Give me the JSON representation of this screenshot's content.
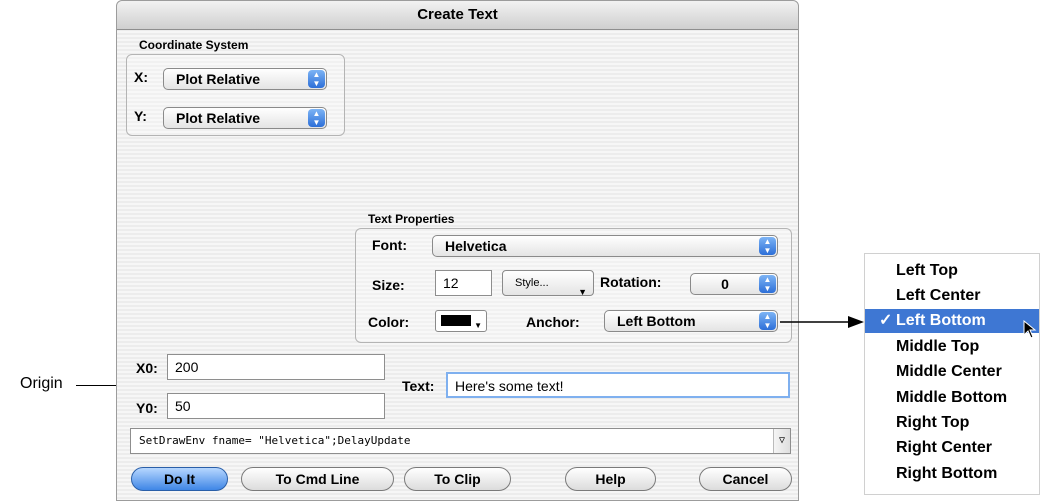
{
  "window": {
    "title": "Create Text"
  },
  "coordinate_system": {
    "label": "Coordinate System",
    "x_label": "X:",
    "x_value": "Plot Relative",
    "y_label": "Y:",
    "y_value": "Plot Relative"
  },
  "text_properties": {
    "label": "Text Properties",
    "font_label": "Font:",
    "font_value": "Helvetica",
    "size_label": "Size:",
    "size_value": "12",
    "style_label": "Style...",
    "rotation_label": "Rotation:",
    "rotation_value": "0",
    "color_label": "Color:",
    "anchor_label": "Anchor:",
    "anchor_value": "Left Bottom"
  },
  "origin": {
    "annotation": "Origin",
    "x0_label": "X0:",
    "x0_value": "200",
    "y0_label": "Y0:",
    "y0_value": "50"
  },
  "text_field": {
    "label": "Text:",
    "value": "Here's some text!"
  },
  "command_line": {
    "value": "SetDrawEnv fname= \"Helvetica\";DelayUpdate"
  },
  "buttons": {
    "do_it": "Do It",
    "to_cmd_line": "To Cmd Line",
    "to_clip": "To Clip",
    "help": "Help",
    "cancel": "Cancel"
  },
  "anchor_menu": {
    "items": [
      "Left Top",
      "Left Center",
      "Left Bottom",
      "Middle Top",
      "Middle Center",
      "Middle Bottom",
      "Right Top",
      "Right Center",
      "Right Bottom"
    ],
    "selected": "Left Bottom",
    "checkmark": "✓"
  },
  "icons": {
    "popup_arrows": "updown-arrows-icon",
    "cursor": "mouse-cursor-icon"
  },
  "colors": {
    "accent": "#3e77d3",
    "text_color_swatch": "#000000"
  }
}
